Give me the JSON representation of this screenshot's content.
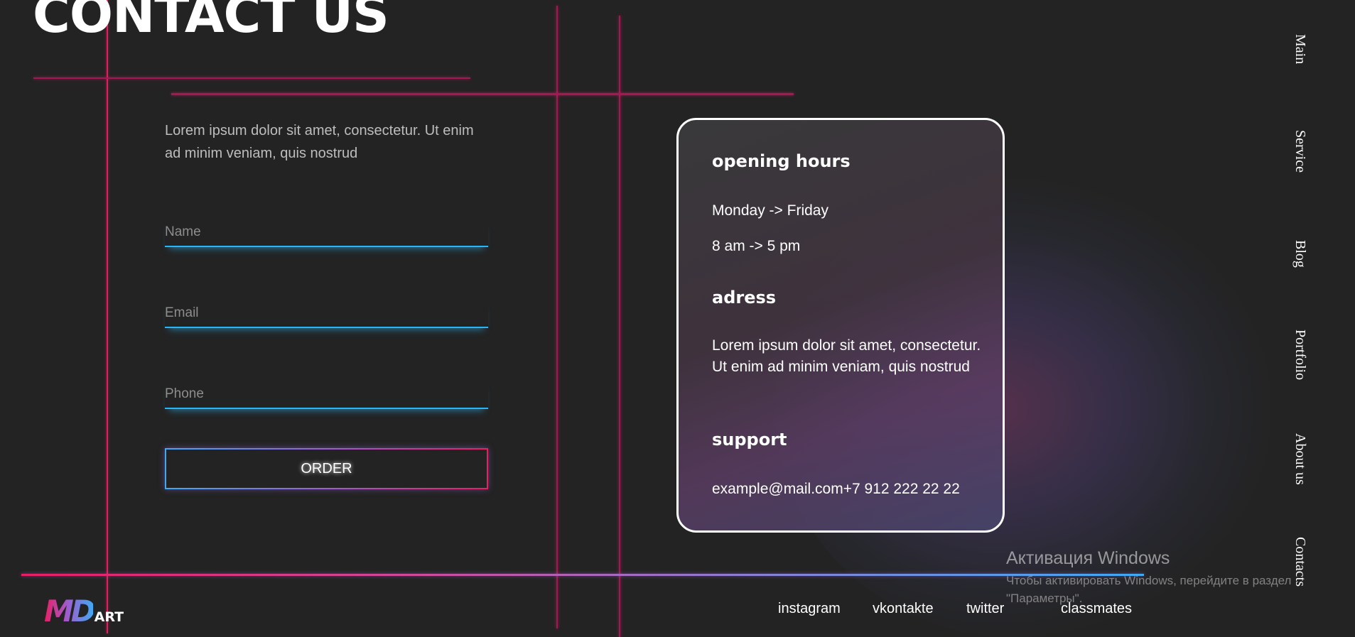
{
  "page": {
    "title": "CONTACT US",
    "intro": "Lorem ipsum dolor sit amet, consectetur. Ut enim ad minim veniam, quis nostrud"
  },
  "form": {
    "name_placeholder": "Name",
    "email_placeholder": "Email",
    "phone_placeholder": "Phone",
    "order_label": "ORDER"
  },
  "info": {
    "hours_heading": "opening hours",
    "days": "Monday -> Friday",
    "time": "8 am -> 5 pm",
    "address_heading": "adress",
    "address_text": "Lorem ipsum dolor sit amet, consectetur. Ut enim ad minim veniam, quis nostrud",
    "support_heading": "support",
    "support_contact": "example@mail.com+7 912 222 22 22"
  },
  "nav": {
    "items": [
      {
        "label": "Main"
      },
      {
        "label": "Service"
      },
      {
        "label": "Blog"
      },
      {
        "label": "Portfolio"
      },
      {
        "label": "About us"
      },
      {
        "label": "Contacts"
      }
    ]
  },
  "footer": {
    "logo_md": "MD",
    "logo_art": "ART",
    "social": [
      {
        "label": "instagram"
      },
      {
        "label": "vkontakte"
      },
      {
        "label": "twitter"
      },
      {
        "label": "classmates"
      }
    ]
  },
  "overlay": {
    "title": "Активация Windows",
    "line1": "Чтобы активировать Windows, перейдите в раздел",
    "line2": "\"Параметры\"."
  },
  "colors": {
    "background": "#232323",
    "accent_pink": "#e91e63",
    "accent_blue": "#29b6f6"
  }
}
